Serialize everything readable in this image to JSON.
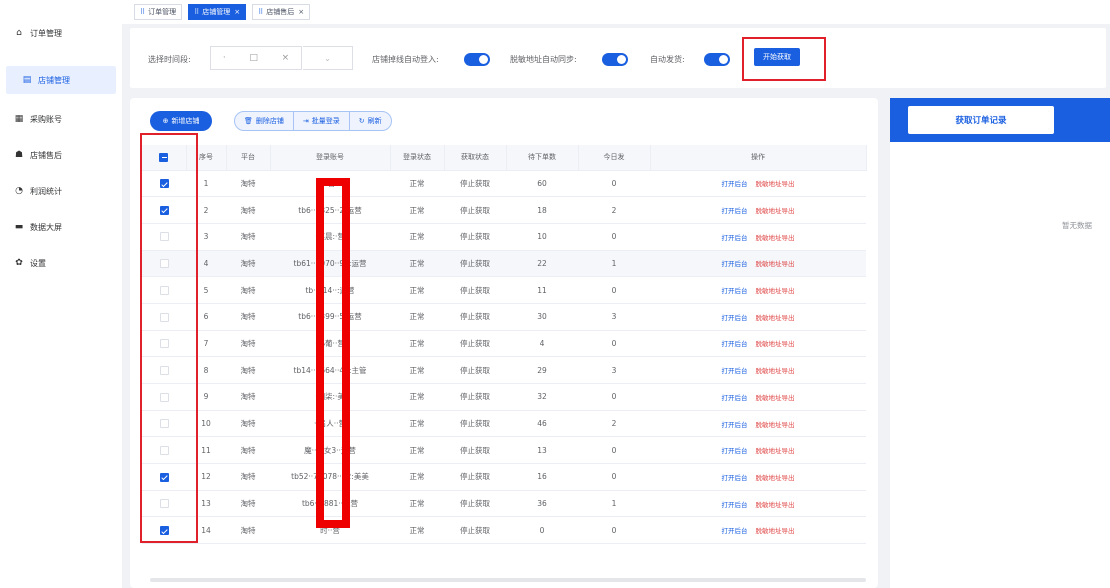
{
  "sidebar": {
    "items": [
      {
        "label": "订单管理",
        "icon": "home-icon"
      },
      {
        "label": "店铺管理",
        "icon": "store-icon"
      },
      {
        "label": "采购账号",
        "icon": "account-icon"
      },
      {
        "label": "店铺售后",
        "icon": "aftersale-icon"
      },
      {
        "label": "利润统计",
        "icon": "chart-icon"
      },
      {
        "label": "数据大屏",
        "icon": "screen-icon"
      },
      {
        "label": "设置",
        "icon": "gear-icon"
      }
    ]
  },
  "tabs": [
    {
      "label": "订单管理",
      "active": false
    },
    {
      "label": "店铺管理",
      "active": true
    },
    {
      "label": "店铺售后",
      "active": false
    }
  ],
  "filter": {
    "time_label": "选择时间段:",
    "range_mid": "□",
    "range_close": "×",
    "select_arrow": "⌄",
    "auto_login_label": "店铺掉线自动登入:",
    "addr_sync_label": "脱敏地址自动同步:",
    "auto_ship_label": "自动发货:",
    "start_button": "开始获取"
  },
  "toolbar": {
    "add_label": "新增店铺",
    "delete_label": "删除店铺",
    "batch_login_label": "批量登录",
    "refresh_label": "刷新"
  },
  "table": {
    "headers": [
      "",
      "序号",
      "平台",
      "登录账号",
      "登录状态",
      "获取状态",
      "待下单数",
      "今日发",
      "操作"
    ],
    "op_open": "打开后台",
    "op_export": "脱敏地址导出",
    "rows": [
      {
        "checked": true,
        "idx": "1",
        "platform": "淘特",
        "account": "-管",
        "login": "正常",
        "fetch": "停止获取",
        "pending": "60",
        "today": "0"
      },
      {
        "checked": true,
        "idx": "2",
        "platform": "淘特",
        "account": "tb6··1825··2:运营",
        "login": "正常",
        "fetch": "停止获取",
        "pending": "18",
        "today": "2"
      },
      {
        "checked": false,
        "idx": "3",
        "platform": "淘特",
        "account": "·笑晨:·营",
        "login": "正常",
        "fetch": "停止获取",
        "pending": "10",
        "today": "0"
      },
      {
        "checked": false,
        "idx": "4",
        "platform": "淘特",
        "account": "tb61··6070··97:运营",
        "login": "正常",
        "fetch": "停止获取",
        "pending": "22",
        "today": "1"
      },
      {
        "checked": false,
        "idx": "5",
        "platform": "淘特",
        "account": "tb··214··:运营",
        "login": "正常",
        "fetch": "停止获取",
        "pending": "11",
        "today": "0"
      },
      {
        "checked": false,
        "idx": "6",
        "platform": "淘特",
        "account": "tb6··7399··5:运营",
        "login": "正常",
        "fetch": "停止获取",
        "pending": "30",
        "today": "3"
      },
      {
        "checked": false,
        "idx": "7",
        "platform": "淘特",
        "account": "·小葡··营",
        "login": "正常",
        "fetch": "停止获取",
        "pending": "4",
        "today": "0"
      },
      {
        "checked": false,
        "idx": "8",
        "platform": "淘特",
        "account": "tb14··2664··43:主管",
        "login": "正常",
        "fetch": "停止获取",
        "pending": "29",
        "today": "3"
      },
      {
        "checked": false,
        "idx": "9",
        "platform": "淘特",
        "account": "·烟柒:·美",
        "login": "正常",
        "fetch": "停止获取",
        "pending": "32",
        "today": "0"
      },
      {
        "checked": false,
        "idx": "10",
        "platform": "淘特",
        "account": "··名人··营",
        "login": "正常",
        "fetch": "停止获取",
        "pending": "46",
        "today": "2"
      },
      {
        "checked": false,
        "idx": "11",
        "platform": "淘特",
        "account": "魔··少女3··运营",
        "login": "正常",
        "fetch": "停止获取",
        "pending": "13",
        "today": "0"
      },
      {
        "checked": true,
        "idx": "12",
        "platform": "淘特",
        "account": "tb52··78078··72:美美",
        "login": "正常",
        "fetch": "停止获取",
        "pending": "16",
        "today": "0"
      },
      {
        "checked": false,
        "idx": "13",
        "platform": "淘特",
        "account": "tb6··6881··运营",
        "login": "正常",
        "fetch": "停止获取",
        "pending": "36",
        "today": "1"
      },
      {
        "checked": true,
        "idx": "14",
        "platform": "淘特",
        "account": "时··营",
        "login": "正常",
        "fetch": "停止获取",
        "pending": "0",
        "today": "0"
      }
    ]
  },
  "right_panel": {
    "button": "获取订单记录",
    "empty_text": "暂无数据"
  },
  "colors": {
    "accent": "#1a5fe0",
    "annotation_red": "#e0202a",
    "link_red": "#e04848"
  }
}
